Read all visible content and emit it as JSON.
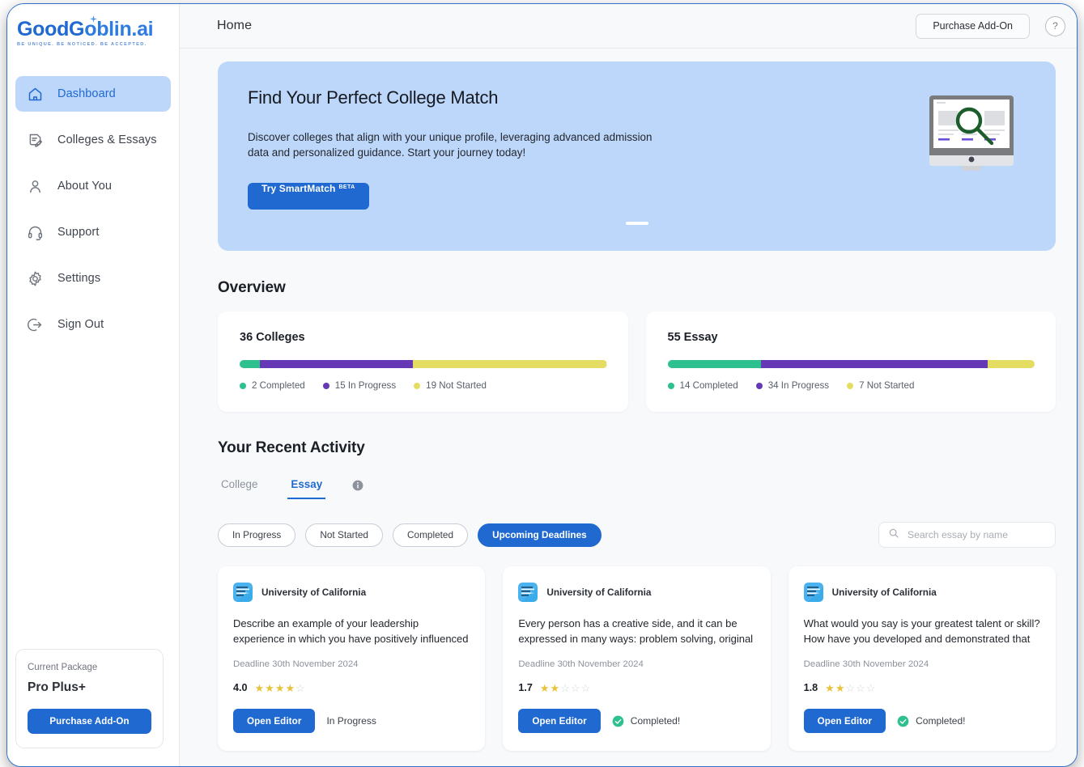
{
  "brand": {
    "name_part1": "GoodG",
    "name_part2": "oblin.ai",
    "tagline": "BE UNIQUE. BE NOTICED. BE ACCEPTED.",
    "accent_color": "#1f69d0"
  },
  "sidebar": {
    "items": [
      {
        "label": "Dashboard",
        "icon": "home-icon",
        "active": true
      },
      {
        "label": "Colleges & Essays",
        "icon": "document-edit-icon",
        "active": false
      },
      {
        "label": "About You",
        "icon": "user-icon",
        "active": false
      },
      {
        "label": "Support",
        "icon": "headset-icon",
        "active": false
      },
      {
        "label": "Settings",
        "icon": "gear-icon",
        "active": false
      },
      {
        "label": "Sign Out",
        "icon": "sign-out-icon",
        "active": false
      }
    ],
    "package": {
      "label": "Current Package",
      "name": "Pro Plus+",
      "button": "Purchase Add-On"
    }
  },
  "topbar": {
    "title": "Home",
    "purchase_button": "Purchase Add-On",
    "help_glyph": "?"
  },
  "hero": {
    "title": "Find Your Perfect College Match",
    "subtitle": "Discover colleges that align with your unique profile, leveraging advanced admission data and personalized guidance. Start your journey today!",
    "cta": "Try SmartMatch",
    "cta_badge": "BETA",
    "background_color": "#bdd7fb",
    "illustration": "monitor-search-icon"
  },
  "overview": {
    "title": "Overview",
    "cards": [
      {
        "heading": "36 Colleges",
        "total": 36,
        "segments": [
          {
            "key": "completed",
            "count": 2,
            "label": "2 Completed",
            "color": "#2ec08e"
          },
          {
            "key": "in_progress",
            "count": 15,
            "label": "15 In Progress",
            "color": "#6539b5"
          },
          {
            "key": "not_started",
            "count": 19,
            "label": "19 Not Started",
            "color": "#e5dc62"
          }
        ]
      },
      {
        "heading": "55 Essay",
        "total": 55,
        "segments": [
          {
            "key": "completed",
            "count": 14,
            "label": "14 Completed",
            "color": "#2ec08e"
          },
          {
            "key": "in_progress",
            "count": 34,
            "label": "34 In Progress",
            "color": "#6539b5"
          },
          {
            "key": "not_started",
            "count": 7,
            "label": "7 Not Started",
            "color": "#e5dc62"
          }
        ]
      }
    ]
  },
  "activity": {
    "title": "Your Recent Activity",
    "tabs": [
      {
        "label": "College",
        "active": false
      },
      {
        "label": "Essay",
        "active": true
      }
    ],
    "info_icon": "info-icon",
    "filters": [
      {
        "label": "In Progress",
        "active": false
      },
      {
        "label": "Not Started",
        "active": false
      },
      {
        "label": "Completed",
        "active": false
      },
      {
        "label": "Upcoming Deadlines",
        "active": true
      }
    ],
    "search": {
      "placeholder": "Search essay by name",
      "value": "",
      "icon": "search-icon"
    },
    "cards": [
      {
        "college": "University of California",
        "logo": "uc-logo-icon",
        "prompt": "Describe an example of your leadership experience in which you have positively influenced others, helped...",
        "deadline": "Deadline 30th November 2024",
        "score": "4.0",
        "stars_filled": 4,
        "stars_total": 5,
        "button": "Open Editor",
        "status": "In Progress",
        "status_complete": false
      },
      {
        "college": "University of California",
        "logo": "uc-logo-icon",
        "prompt": "Every person has a creative side, and it can be expressed in many ways: problem solving, original and innovative...",
        "deadline": "Deadline 30th November 2024",
        "score": "1.7",
        "stars_filled": 2,
        "stars_total": 5,
        "button": "Open Editor",
        "status": "Completed!",
        "status_complete": true
      },
      {
        "college": "University of California",
        "logo": "uc-logo-icon",
        "prompt": "What would you say is your greatest talent or skill? How have you developed and demonstrated that talent over...",
        "deadline": "Deadline 30th November 2024",
        "score": "1.8",
        "stars_filled": 2,
        "stars_total": 5,
        "button": "Open Editor",
        "status": "Completed!",
        "status_complete": true
      }
    ]
  }
}
